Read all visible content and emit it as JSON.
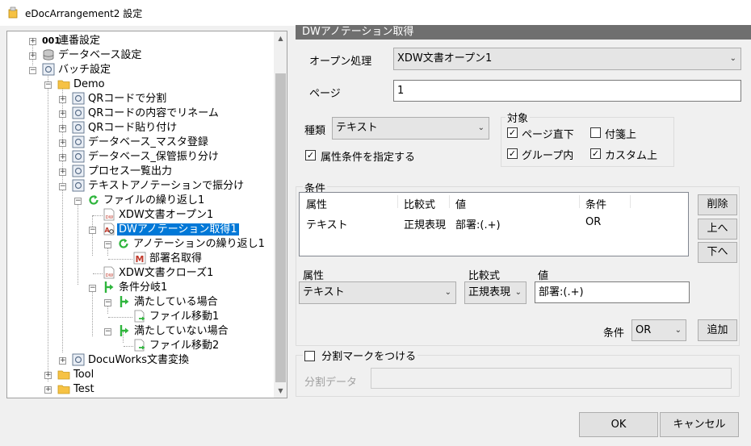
{
  "window": {
    "title": "eDocArrangement2 設定",
    "close_glyph": "✕"
  },
  "tree": {
    "items": [
      {
        "label": "連番設定",
        "prefix": "001"
      },
      {
        "label": "データベース設定"
      },
      {
        "label": "バッチ設定"
      },
      {
        "label": "Demo"
      },
      {
        "label": "QRコードで分割"
      },
      {
        "label": "QRコードの内容でリネーム"
      },
      {
        "label": "QRコード貼り付け"
      },
      {
        "label": "データベース_マスタ登録"
      },
      {
        "label": "データベース_保管振り分け"
      },
      {
        "label": "プロセス一覧出力"
      },
      {
        "label": "テキストアノテーションで振分け"
      },
      {
        "label": "ファイルの繰り返し1"
      },
      {
        "label": "XDW文書オープン1"
      },
      {
        "label": "DWアノテーション取得1",
        "selected": true
      },
      {
        "label": "アノテーションの繰り返し1"
      },
      {
        "label": "部署名取得"
      },
      {
        "label": "XDW文書クローズ1"
      },
      {
        "label": "条件分岐1"
      },
      {
        "label": "満たしている場合"
      },
      {
        "label": "ファイル移動1"
      },
      {
        "label": "満たしていない場合"
      },
      {
        "label": "ファイル移動2"
      },
      {
        "label": "DocuWorks文書変換"
      },
      {
        "label": "Tool"
      },
      {
        "label": "Test"
      }
    ],
    "icon_text": {
      "dw": "DW",
      "m": "M"
    }
  },
  "panel": {
    "header": "DWアノテーション取得",
    "open_process_label": "オープン処理",
    "open_process_value": "XDW文書オープン1",
    "page_label": "ページ",
    "page_value": "1",
    "kind_label": "種類",
    "kind_value": "テキスト",
    "target_group_label": "対象",
    "targets": {
      "page_direct": {
        "label": "ページ直下",
        "checked": true
      },
      "sticky": {
        "label": "付箋上",
        "checked": false
      },
      "in_group": {
        "label": "グループ内",
        "checked": true
      },
      "on_custom": {
        "label": "カスタム上",
        "checked": true
      }
    },
    "attr_condition_label": "属性条件を指定する",
    "attr_condition_checked": true,
    "conditions_group_label": "条件",
    "list_headers": [
      "属性",
      "比較式",
      "値",
      "条件"
    ],
    "list_rows": [
      [
        "テキスト",
        "正規表現",
        "部署:(.+)",
        "OR"
      ]
    ],
    "delete_button": "削除",
    "up_button": "上へ",
    "down_button": "下へ",
    "attr_label": "属性",
    "attr_value": "テキスト",
    "compare_label": "比較式",
    "compare_value": "正規表現",
    "value_label": "値",
    "value_value": "部署:(.+)",
    "condition_label": "条件",
    "condition_value": "OR",
    "add_button": "追加",
    "split_mark_label": "分割マークをつける",
    "split_mark_checked": false,
    "split_data_label": "分割データ",
    "split_data_value": ""
  },
  "footer": {
    "ok": "OK",
    "cancel": "キャンセル"
  },
  "glyphs": {
    "check": "✓",
    "combo_arrow": "⌄",
    "expand": "+",
    "collapse": "−",
    "scroll_up": "▲",
    "scroll_down": "▼"
  },
  "colors": {
    "selection": "#0078d7",
    "header_bar": "#6f6f6f",
    "folder": "#f6c244",
    "branch": "#2fb53d"
  }
}
